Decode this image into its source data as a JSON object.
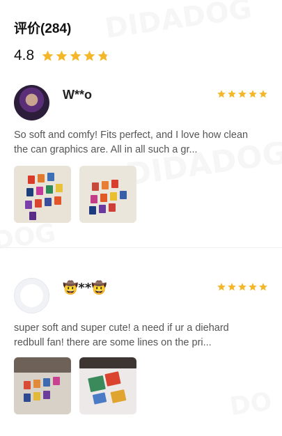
{
  "reviews_section": {
    "title": "评价(284)",
    "average_rating": "4.8",
    "average_stars": 4.8,
    "star_color": "#f5b72a"
  },
  "reviews": [
    {
      "username": "W**o",
      "stars": 5,
      "text": "So soft and comfy! Fits perfect, and I love how clean the can graphics are. All in all such a gr...",
      "avatar": "user-photo",
      "thumbnail_count": 2
    },
    {
      "username": "🤠**🤠",
      "stars": 5,
      "text": "super soft and super cute! a need if ur a diehard redbull fan! there are some lines on the pri...",
      "avatar": "default-avatar",
      "thumbnail_count": 2
    }
  ]
}
